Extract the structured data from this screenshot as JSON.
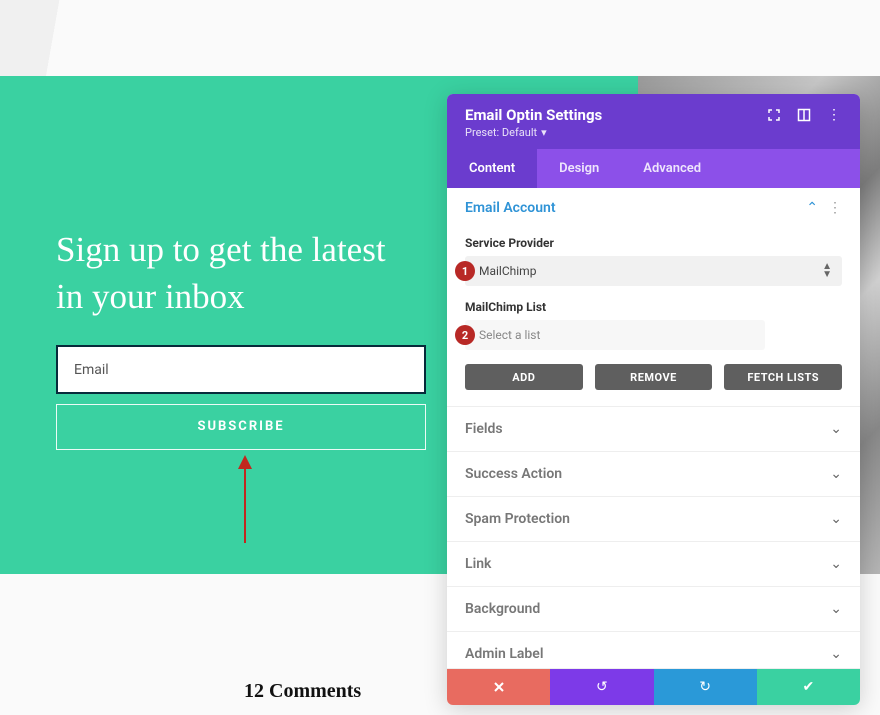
{
  "hero": {
    "headline": "Sign up to get the latest in your inbox",
    "email_placeholder": "Email",
    "subscribe_label": "SUBSCRIBE"
  },
  "comments_heading": "12 Comments",
  "panel": {
    "title": "Email Optin Settings",
    "preset_label": "Preset: Default",
    "tabs": {
      "content": "Content",
      "design": "Design",
      "advanced": "Advanced"
    },
    "email_account": {
      "title": "Email Account",
      "service_provider_label": "Service Provider",
      "service_provider_value": "MailChimp",
      "list_label": "MailChimp List",
      "list_placeholder": "Select a list",
      "buttons": {
        "add": "ADD",
        "remove": "REMOVE",
        "fetch": "FETCH LISTS"
      }
    },
    "sections": [
      "Fields",
      "Success Action",
      "Spam Protection",
      "Link",
      "Background",
      "Admin Label"
    ]
  },
  "markers": {
    "one": "1",
    "two": "2"
  }
}
